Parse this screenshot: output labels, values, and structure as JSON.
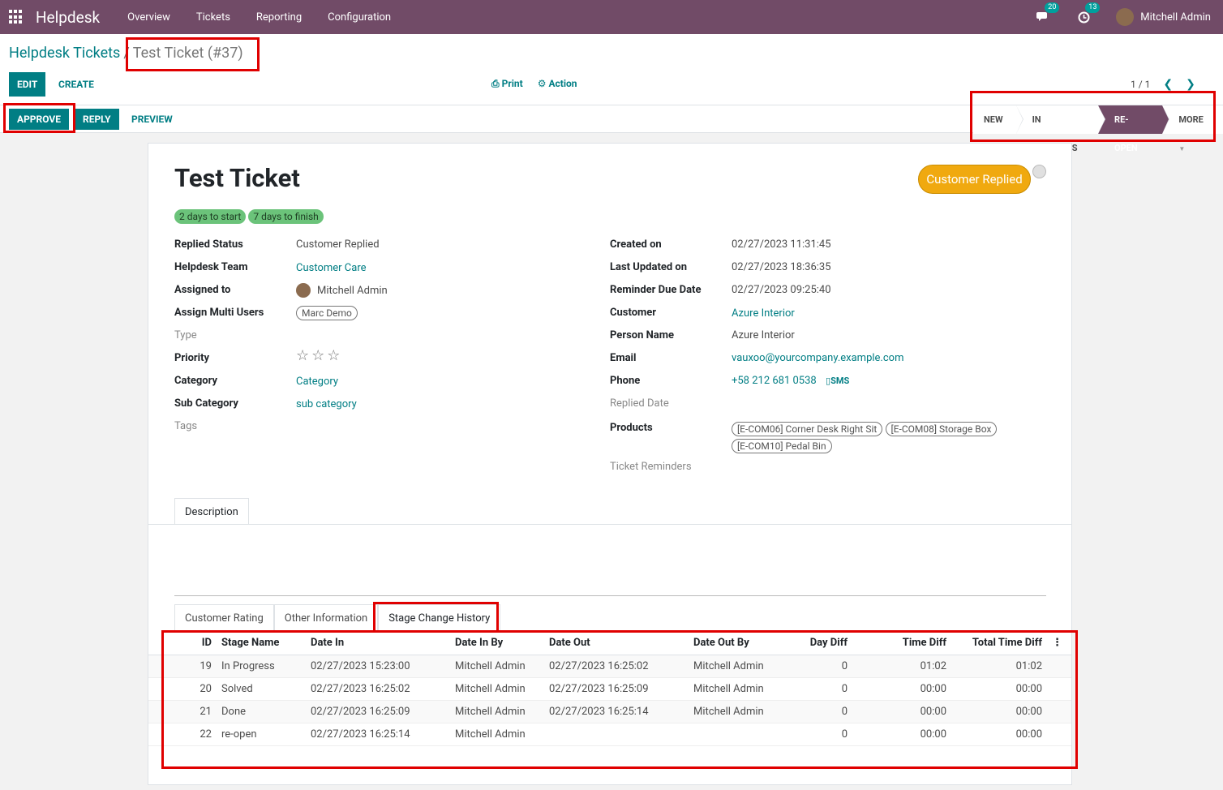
{
  "navbar": {
    "app_name": "Helpdesk",
    "menu": [
      "Overview",
      "Tickets",
      "Reporting",
      "Configuration"
    ],
    "messages_count": "20",
    "activities_count": "13",
    "user_name": "Mitchell Admin"
  },
  "breadcrumb": {
    "parent": "Helpdesk Tickets",
    "separator": "/",
    "current": "Test Ticket (#37)"
  },
  "toolbar": {
    "edit": "EDIT",
    "create": "CREATE",
    "print": "Print",
    "action": "Action",
    "pager": "1 / 1"
  },
  "statusbar": {
    "approve": "APPROVE",
    "reply": "REPLY",
    "preview": "PREVIEW",
    "stages": [
      "NEW",
      "IN PROGRESS",
      "RE-OPEN",
      "MORE"
    ],
    "active_stage": "RE-OPEN"
  },
  "ticket": {
    "title": "Test Ticket",
    "status_button": "Customer Replied",
    "deadline_tags": [
      "2 days to start",
      "7 days to finish"
    ],
    "left": {
      "replied_status": {
        "label": "Replied Status",
        "value": "Customer Replied"
      },
      "helpdesk_team": {
        "label": "Helpdesk Team",
        "value": "Customer Care"
      },
      "assigned_to": {
        "label": "Assigned to",
        "value": "Mitchell Admin"
      },
      "assign_multi": {
        "label": "Assign Multi Users",
        "value": "Marc Demo"
      },
      "type": {
        "label": "Type"
      },
      "priority": {
        "label": "Priority",
        "value": "0 of 3 stars"
      },
      "category": {
        "label": "Category",
        "value": "Category"
      },
      "sub_category": {
        "label": "Sub Category",
        "value": "sub category"
      },
      "tags": {
        "label": "Tags"
      }
    },
    "right": {
      "created_on": {
        "label": "Created on",
        "value": "02/27/2023 11:31:45"
      },
      "last_updated": {
        "label": "Last Updated on",
        "value": "02/27/2023 18:36:35"
      },
      "reminder_due": {
        "label": "Reminder Due Date",
        "value": "02/27/2023 09:25:40"
      },
      "customer": {
        "label": "Customer",
        "value": "Azure Interior"
      },
      "person_name": {
        "label": "Person Name",
        "value": "Azure Interior"
      },
      "email": {
        "label": "Email",
        "value": "vauxoo@yourcompany.example.com"
      },
      "phone": {
        "label": "Phone",
        "value": "+58 212 681 0538",
        "sms": "SMS"
      },
      "replied_date": {
        "label": "Replied Date"
      },
      "products": {
        "label": "Products",
        "items": [
          "[E-COM06] Corner Desk Right Sit",
          "[E-COM08] Storage Box",
          "[E-COM10] Pedal Bin"
        ]
      },
      "ticket_reminders": {
        "label": "Ticket Reminders"
      }
    }
  },
  "tabs_top": [
    "Description"
  ],
  "tabs_bottom": [
    "Customer Rating",
    "Other Information",
    "Stage Change History"
  ],
  "history": {
    "columns": [
      "ID",
      "Stage Name",
      "Date In",
      "Date In By",
      "Date Out",
      "Date Out By",
      "Day Diff",
      "Time Diff",
      "Total Time Diff"
    ],
    "rows": [
      [
        "19",
        "In Progress",
        "02/27/2023 15:23:00",
        "Mitchell Admin",
        "02/27/2023 16:25:02",
        "Mitchell Admin",
        "0",
        "01:02",
        "01:02"
      ],
      [
        "20",
        "Solved",
        "02/27/2023 16:25:02",
        "Mitchell Admin",
        "02/27/2023 16:25:09",
        "Mitchell Admin",
        "0",
        "00:00",
        "00:00"
      ],
      [
        "21",
        "Done",
        "02/27/2023 16:25:09",
        "Mitchell Admin",
        "02/27/2023 16:25:14",
        "Mitchell Admin",
        "0",
        "00:00",
        "00:00"
      ],
      [
        "22",
        "re-open",
        "02/27/2023 16:25:14",
        "Mitchell Admin",
        "",
        "",
        "0",
        "00:00",
        "00:00"
      ]
    ]
  },
  "colors": {
    "brand": "#714b67",
    "accent": "#017e84",
    "highlight": "#e00000",
    "status_button": "#f0a90f"
  }
}
